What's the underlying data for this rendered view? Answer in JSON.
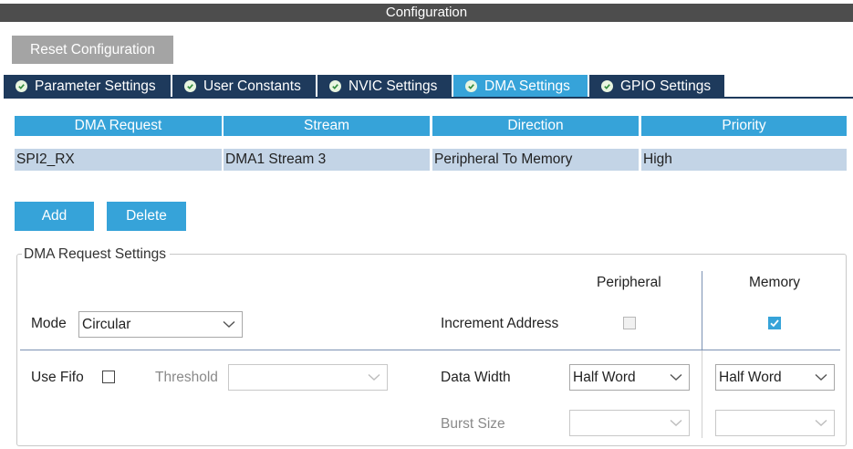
{
  "title": "Configuration",
  "reset_button": "Reset Configuration",
  "tabs": [
    {
      "label": "Parameter Settings",
      "active": false
    },
    {
      "label": "User Constants",
      "active": false
    },
    {
      "label": "NVIC Settings",
      "active": false
    },
    {
      "label": "DMA Settings",
      "active": true
    },
    {
      "label": "GPIO Settings",
      "active": false
    }
  ],
  "dma_table": {
    "headers": [
      "DMA Request",
      "Stream",
      "Direction",
      "Priority"
    ],
    "rows": [
      [
        "SPI2_RX",
        "DMA1 Stream 3",
        "Peripheral To Memory",
        "High"
      ]
    ]
  },
  "actions": {
    "add": "Add",
    "delete": "Delete"
  },
  "settings": {
    "group_title": "DMA Request Settings",
    "peripheral_header": "Peripheral",
    "memory_header": "Memory",
    "mode_label": "Mode",
    "mode_value": "Circular",
    "increment_label": "Increment Address",
    "increment_peripheral_checked": false,
    "increment_memory_checked": true,
    "use_fifo_label": "Use Fifo",
    "use_fifo_checked": false,
    "threshold_label": "Threshold",
    "threshold_value": "",
    "data_width_label": "Data Width",
    "data_width_peripheral": "Half Word",
    "data_width_memory": "Half Word",
    "burst_size_label": "Burst Size",
    "burst_size_peripheral": "",
    "burst_size_memory": ""
  },
  "colors": {
    "accent": "#36a3d9",
    "tab_dark": "#1e3a5c",
    "title_bar": "#4d4d4d",
    "row_selected": "#c3d4e6",
    "reset_button": "#a4a4a4"
  }
}
